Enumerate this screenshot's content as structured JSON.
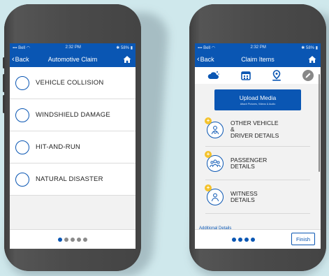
{
  "left_phone": {
    "status": {
      "carrier": "Bell",
      "time": "2:32 PM",
      "battery": "58%"
    },
    "nav": {
      "back_label": "Back",
      "title": "Automotive Claim"
    },
    "claim_types": [
      "VEHICLE COLLISION",
      "WINDSHIELD DAMAGE",
      "HIT-AND-RUN",
      "NATURAL DISASTER"
    ],
    "pager": {
      "total": 5,
      "current": 1
    }
  },
  "right_phone": {
    "status": {
      "carrier": "Bell",
      "time": "2:32 PM",
      "battery": "58%"
    },
    "nav": {
      "back_label": "Back",
      "title": "Claim Items"
    },
    "top_icons": [
      "weather-icon",
      "calendar-icon",
      "location-pin-icon",
      "edit-icon"
    ],
    "upload": {
      "title": "Upload Media",
      "subtitle": "Attach Pictures, Videos & Audio"
    },
    "items": [
      {
        "label_lines": [
          "OTHER VEHICLE",
          "&",
          "DRIVER DETAILS"
        ],
        "icon": "driver-icon"
      },
      {
        "label_lines": [
          "PASSENGER",
          "DETAILS"
        ],
        "icon": "passengers-icon"
      },
      {
        "label_lines": [
          "WITNESS",
          "DETAILS"
        ],
        "icon": "witness-icon"
      }
    ],
    "additional_label": "Additional Details",
    "pager": {
      "total": 4,
      "current": 4
    },
    "finish_label": "Finish"
  },
  "colors": {
    "primary": "#0a56b3",
    "accent": "#f4c22b",
    "background": "#cfe8ec",
    "device": "#4a4a4a"
  }
}
